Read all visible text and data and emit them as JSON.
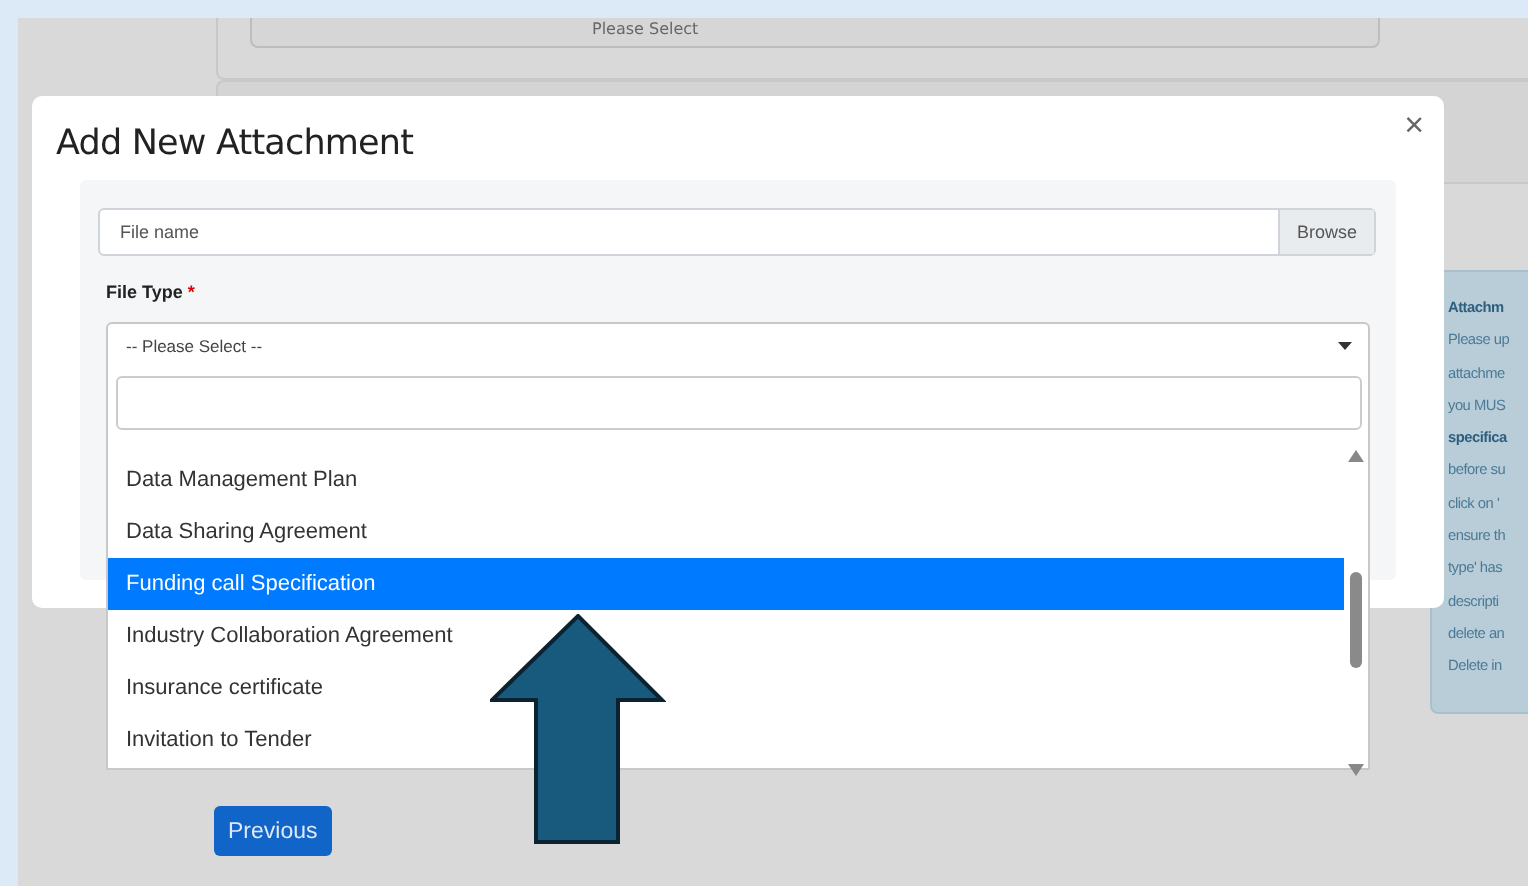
{
  "background_page": {
    "select": {
      "value": "Please Select"
    },
    "info_panel": {
      "lines": [
        {
          "text": "Attachm",
          "kind": "heading"
        },
        {
          "text": "Please up",
          "kind": "text"
        },
        {
          "text": "attachme",
          "kind": "text"
        },
        {
          "text": "you MUS",
          "kind": "text"
        },
        {
          "text": "specifica",
          "kind": "emphasis"
        },
        {
          "text": "before su",
          "kind": "text"
        },
        {
          "text": "click on '",
          "kind": "text"
        },
        {
          "text": "ensure th",
          "kind": "text"
        },
        {
          "text": "type' has",
          "kind": "text"
        },
        {
          "text": "descripti",
          "kind": "text"
        },
        {
          "text": "delete an",
          "kind": "text"
        },
        {
          "text": "Delete in",
          "kind": "text"
        }
      ]
    },
    "previous_button": "Previous"
  },
  "modal": {
    "title": "Add New Attachment",
    "close": "×",
    "file_input": {
      "placeholder": "File name",
      "button": "Browse"
    },
    "file_type": {
      "label": "File Type",
      "required_mark": "*",
      "value": "-- Please Select --"
    },
    "dropdown": {
      "options": [
        {
          "label": "Data Management Plan",
          "selected": false
        },
        {
          "label": "Data Sharing Agreement",
          "selected": false
        },
        {
          "label": "Funding call Specification",
          "selected": true
        },
        {
          "label": "Industry Collaboration Agreement",
          "selected": false
        },
        {
          "label": "Insurance certificate",
          "selected": false
        },
        {
          "label": "Invitation to Tender",
          "selected": false
        }
      ]
    }
  }
}
